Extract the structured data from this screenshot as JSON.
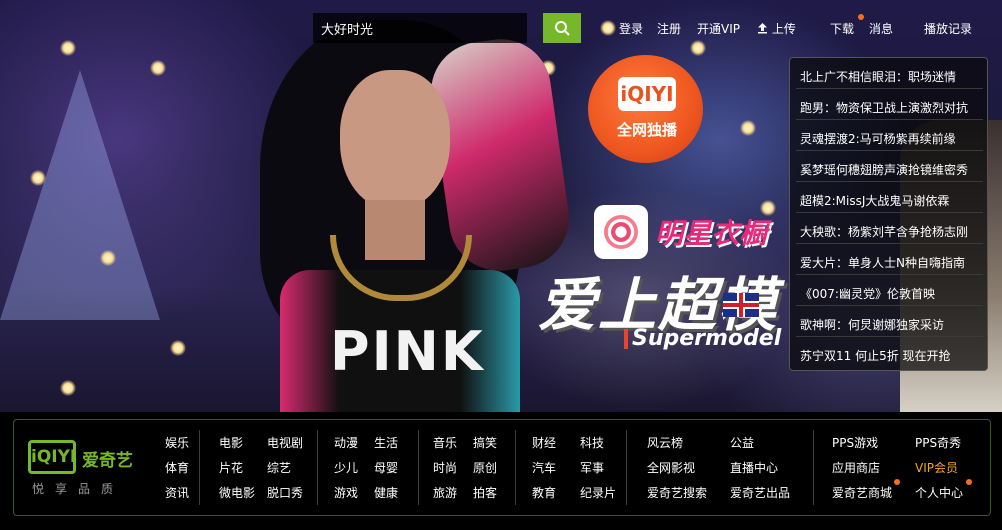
{
  "search": {
    "value": "大好时光",
    "button_icon": "search-icon"
  },
  "topnav": {
    "login": "登录",
    "register": "注册",
    "vip": "开通VIP",
    "upload": "上传",
    "download": "下载",
    "messages": "消息",
    "history": "播放记录"
  },
  "promo": {
    "badge_logo": "iQIYI",
    "badge_text": "全网独播",
    "brand_text": "明星衣橱",
    "show_title": "爱上超模",
    "show_subtitle": "Supermodel"
  },
  "news": [
    "北上广不相信眼泪：职场迷情",
    "跑男：物资保卫战上演激烈对抗",
    "灵魂摆渡2:马可杨紫再续前缘",
    "奚梦瑶何穗翅膀声演抢镜维密秀",
    "超模2:MissJ大战鬼马谢依霖",
    "大秧歌：杨紫刘芊含争抢杨志刚",
    "爱大片：单身人士N种自嗨指南",
    "《007:幽灵党》伦敦首映",
    "歌神啊：何炅谢娜独家采访",
    "苏宁双11 何止5折 现在开抢"
  ],
  "footer": {
    "logo_box": "iQIYI",
    "logo_name": "爱奇艺",
    "slogan": "悦享品质",
    "groups": [
      {
        "items": [
          "娱乐",
          "体育",
          "资讯"
        ]
      },
      {
        "items": [
          "电影",
          "片花",
          "微电影"
        ]
      },
      {
        "items": [
          "电视剧",
          "综艺",
          "脱口秀"
        ]
      },
      {
        "items": [
          "动漫",
          "少儿",
          "游戏"
        ]
      },
      {
        "items": [
          "生活",
          "母婴",
          "健康"
        ]
      },
      {
        "items": [
          "音乐",
          "时尚",
          "旅游"
        ]
      },
      {
        "items": [
          "搞笑",
          "原创",
          "拍客"
        ]
      },
      {
        "items": [
          "财经",
          "汽车",
          "教育"
        ]
      },
      {
        "items": [
          "科技",
          "军事",
          "纪录片"
        ]
      },
      {
        "items": [
          "风云榜",
          "全网影视",
          "爱奇艺搜索"
        ]
      },
      {
        "items": [
          "公益",
          "直播中心",
          "爱奇艺出品"
        ]
      },
      {
        "items": [
          "PPS游戏",
          "应用商店",
          "爱奇艺商城"
        ]
      },
      {
        "items": [
          "PPS奇秀",
          "VIP会员",
          "个人中心"
        ]
      }
    ],
    "highlight_color": "#f5a623",
    "accent_color": "#76b82a"
  }
}
